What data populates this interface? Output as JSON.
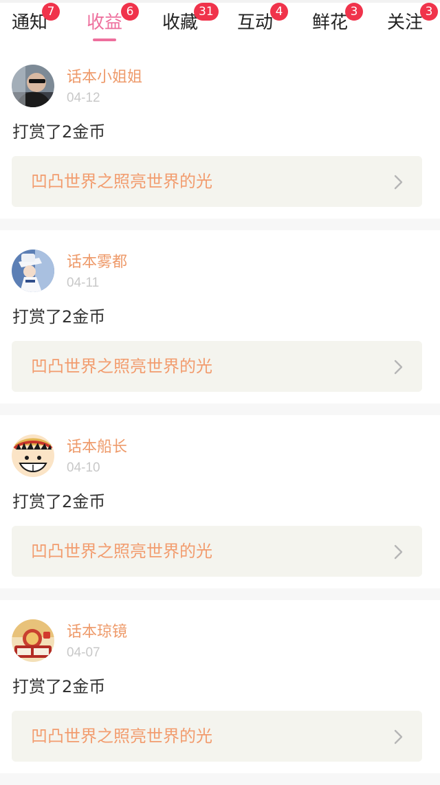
{
  "tabs": [
    {
      "label": "通知",
      "badge": "7",
      "active": false
    },
    {
      "label": "收益",
      "badge": "6",
      "active": true
    },
    {
      "label": "收藏",
      "badge": "31",
      "active": false
    },
    {
      "label": "互动",
      "badge": "4",
      "active": false
    },
    {
      "label": "鲜花",
      "badge": "3",
      "active": false
    },
    {
      "label": "关注",
      "badge": "3",
      "active": false
    }
  ],
  "feed": {
    "items": [
      {
        "user": "话本小姐姐",
        "date": "04-12",
        "action": "打赏了2金币",
        "work": "凹凸世界之照亮世界的光",
        "avatar": "avatar-person-sunglasses"
      },
      {
        "user": "话本雾都",
        "date": "04-11",
        "action": "打赏了2金币",
        "work": "凹凸世界之照亮世界的光",
        "avatar": "avatar-anime-white-hat"
      },
      {
        "user": "话本船长",
        "date": "04-10",
        "action": "打赏了2金币",
        "work": "凹凸世界之照亮世界的光",
        "avatar": "avatar-straw-hat-cartoon"
      },
      {
        "user": "话本琼镜",
        "date": "04-07",
        "action": "打赏了2金币",
        "work": "凹凸世界之照亮世界的光",
        "avatar": "avatar-red-gold-emblem"
      }
    ]
  },
  "colors": {
    "accent_pink": "#ee6f9d",
    "badge_red": "#f0334b",
    "username_orange": "#ee9a6a",
    "work_title_orange": "#f29c6e",
    "work_bg": "#f4f4ee"
  },
  "icons": {
    "chevron": "chevron-right-icon"
  }
}
